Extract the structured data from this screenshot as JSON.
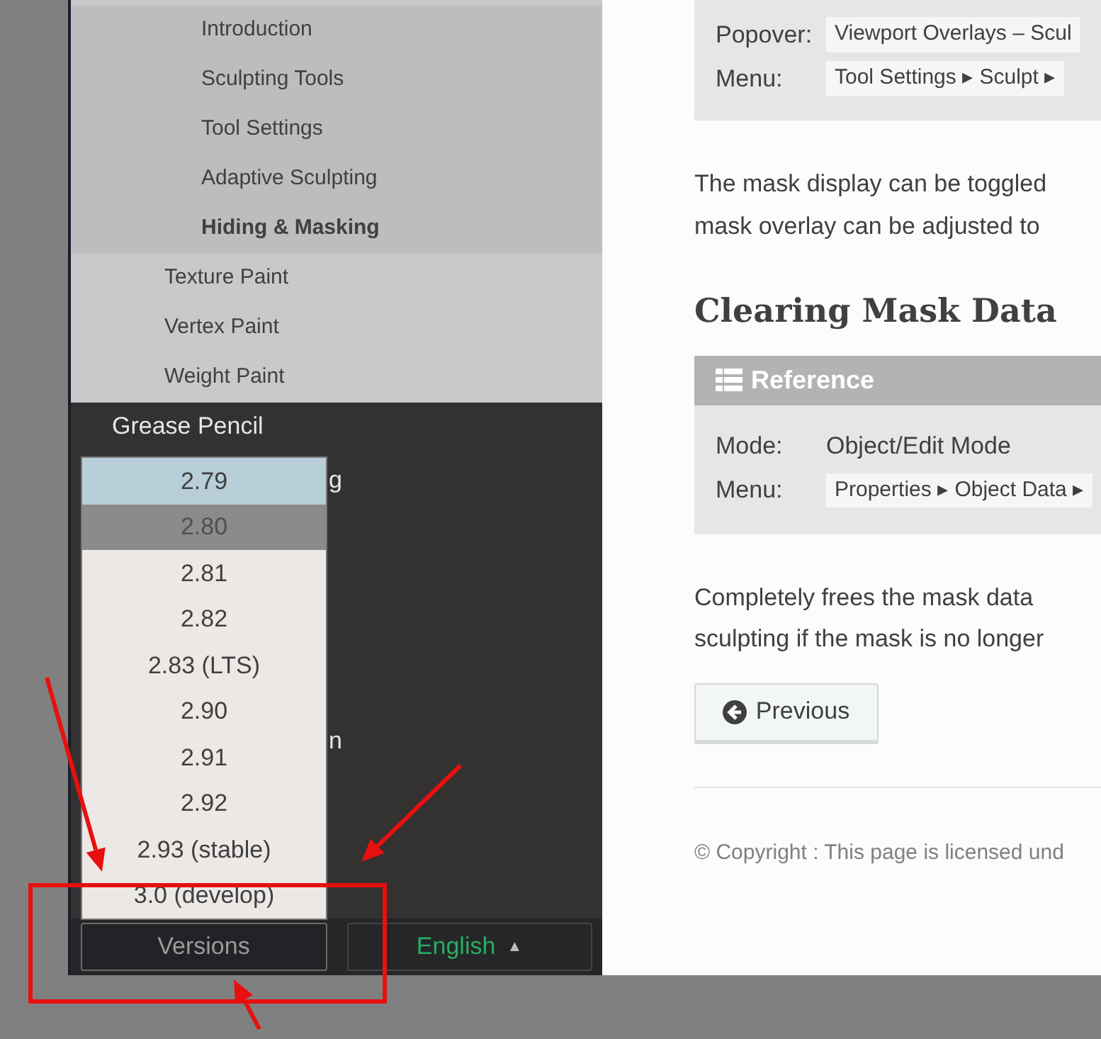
{
  "sidebar": {
    "subsection_items": [
      {
        "label": "Introduction",
        "current": false
      },
      {
        "label": "Sculpting Tools",
        "current": false
      },
      {
        "label": "Tool Settings",
        "current": false
      },
      {
        "label": "Adaptive Sculpting",
        "current": false
      },
      {
        "label": "Hiding & Masking",
        "current": true
      }
    ],
    "section_items": [
      "Texture Paint",
      "Vertex Paint",
      "Weight Paint"
    ],
    "top_items": [
      "Grease Pencil"
    ],
    "partial_items": [
      "g",
      "n"
    ]
  },
  "versions_dropdown": {
    "items": [
      {
        "label": "2.79",
        "selected": true,
        "hovered": false
      },
      {
        "label": "2.80",
        "selected": false,
        "hovered": true
      },
      {
        "label": "2.81",
        "selected": false,
        "hovered": false
      },
      {
        "label": "2.82",
        "selected": false,
        "hovered": false
      },
      {
        "label": "2.83 (LTS)",
        "selected": false,
        "hovered": false
      },
      {
        "label": "2.90",
        "selected": false,
        "hovered": false
      },
      {
        "label": "2.91",
        "selected": false,
        "hovered": false
      },
      {
        "label": "2.92",
        "selected": false,
        "hovered": false
      },
      {
        "label": "2.93 (stable)",
        "selected": false,
        "hovered": false
      },
      {
        "label": "3.0 (develop)",
        "selected": false,
        "hovered": false
      }
    ]
  },
  "footer_bar": {
    "versions_button": "Versions",
    "language_button": "English",
    "language_caret": "▲"
  },
  "content": {
    "reference_top": {
      "rows": [
        {
          "label": "Popover:",
          "value": "Viewport Overlays – Scul",
          "kind": "menu"
        },
        {
          "label": "Menu:",
          "value": "Tool Settings ▸ Sculpt ▸",
          "kind": "menu"
        }
      ]
    },
    "paragraph_1": [
      "The mask display can be toggled",
      "mask overlay can be adjusted to"
    ],
    "heading": "Clearing Mask Data",
    "reference": {
      "title": "Reference",
      "rows": [
        {
          "label": "Mode:",
          "value": "Object/Edit Mode",
          "kind": "text"
        },
        {
          "label": "Menu:",
          "value": "Properties ▸ Object Data ▸",
          "kind": "menu"
        }
      ]
    },
    "paragraph_2": [
      "Completely frees the mask data",
      "sculpting if the mask is no longer"
    ],
    "previous_button": "Previous",
    "copyright": "© Copyright : This page is licensed und"
  }
}
